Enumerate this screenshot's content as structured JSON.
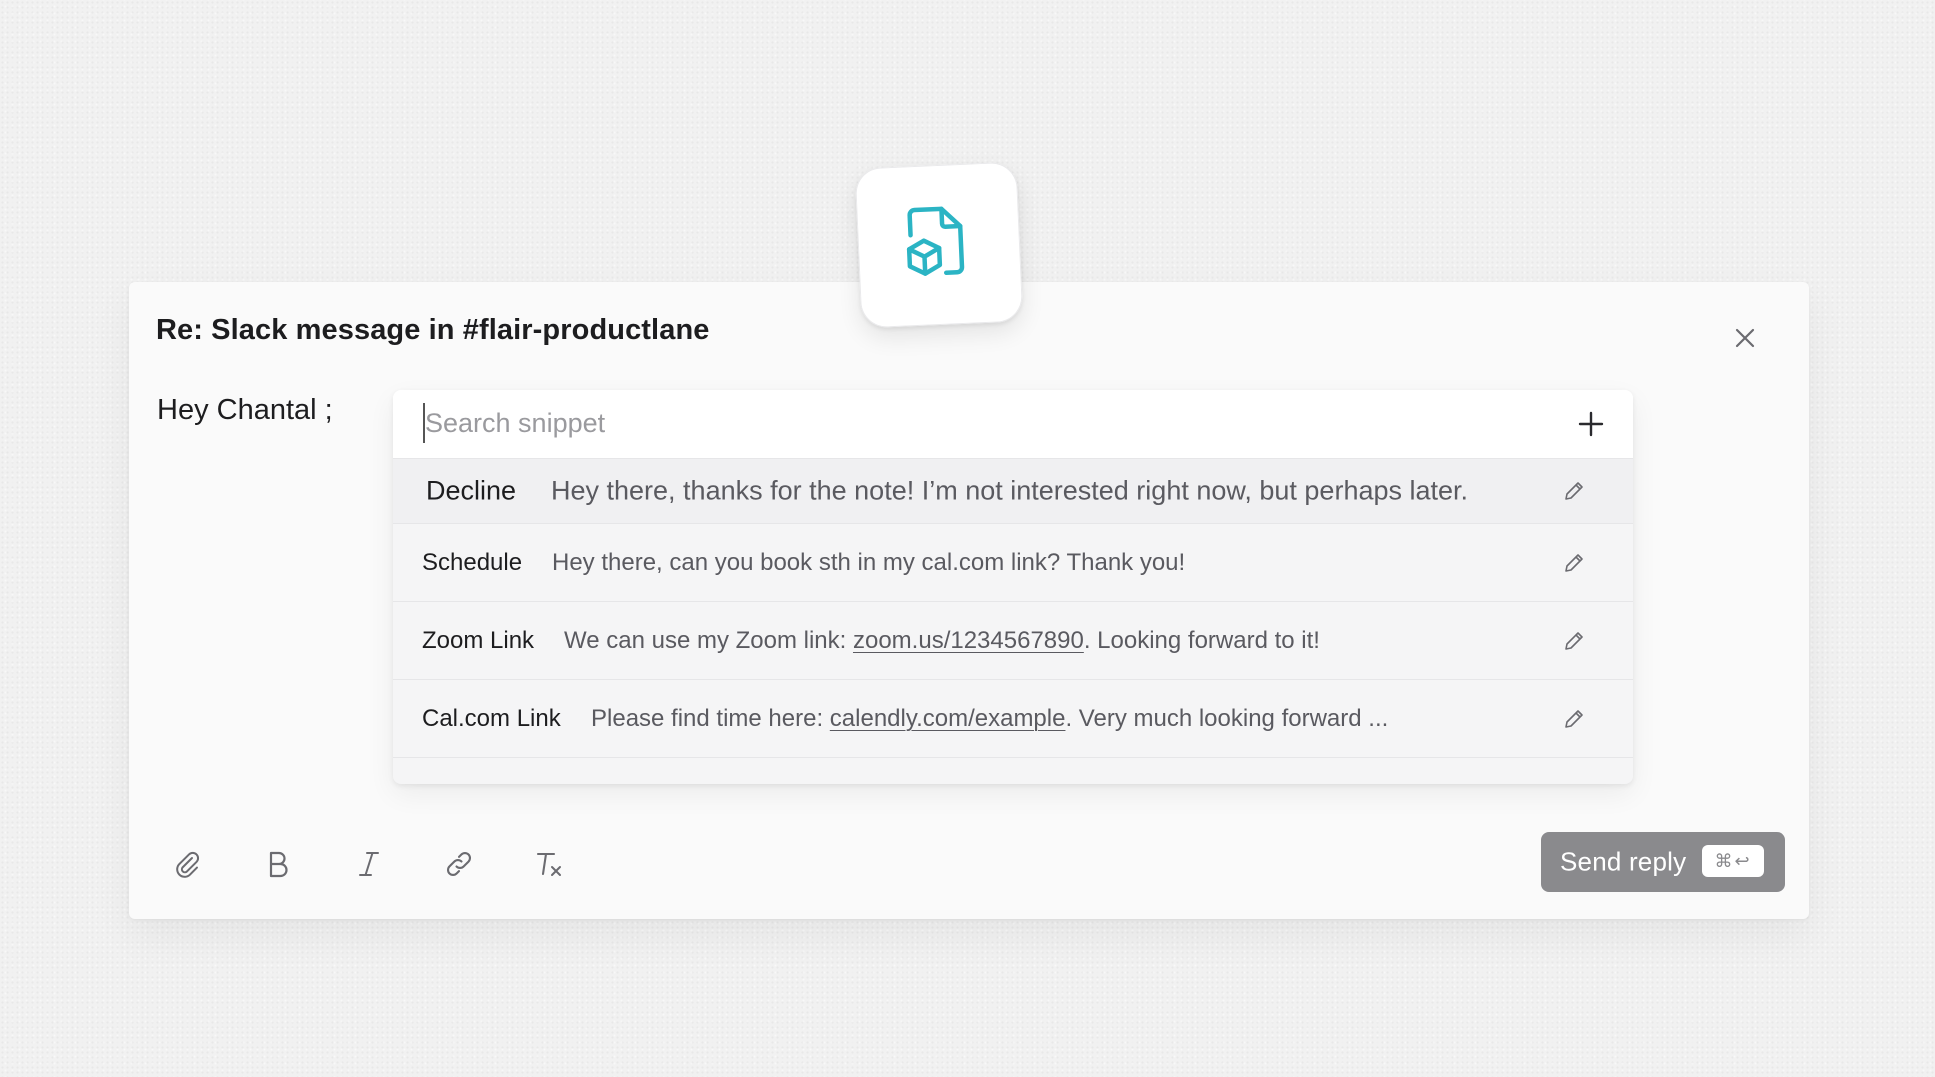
{
  "app_icon": "document-cube-icon",
  "composer": {
    "title": "Re: Slack message in #flair-productlane",
    "greeting": "Hey Chantal ;",
    "close_icon": "close-icon"
  },
  "snippets": {
    "search": {
      "value": "",
      "placeholder": "Search snippet"
    },
    "add_icon": "plus-icon",
    "items": [
      {
        "name": "Decline",
        "text_before": "Hey there, thanks for the note! I’m not interested right now, but perhaps later.",
        "link": "",
        "text_after": "",
        "icon": "pencil-icon"
      },
      {
        "name": "Schedule",
        "text_before": "Hey there, can you book sth in my cal.com link? Thank you!",
        "link": "",
        "text_after": "",
        "icon": "pencil-icon"
      },
      {
        "name": "Zoom Link",
        "text_before": "We can use my Zoom link: ",
        "link": "zoom.us/1234567890",
        "text_after": ". Looking forward to it!",
        "icon": "pencil-icon"
      },
      {
        "name": "Cal.com Link",
        "text_before": "Please find time here: ",
        "link": "calendly.com/example",
        "text_after": ". Very much looking forward ...",
        "icon": "pencil-icon"
      }
    ]
  },
  "toolbar": {
    "tools": [
      "paperclip-icon",
      "bold-icon",
      "italic-icon",
      "link-icon",
      "clear-format-icon"
    ]
  },
  "send": {
    "label": "Send reply",
    "shortcut": "⌘↩"
  },
  "colors": {
    "accent": "#2bb4c4",
    "send_button": "#8a8a8d",
    "background": "#f1f1f1"
  }
}
